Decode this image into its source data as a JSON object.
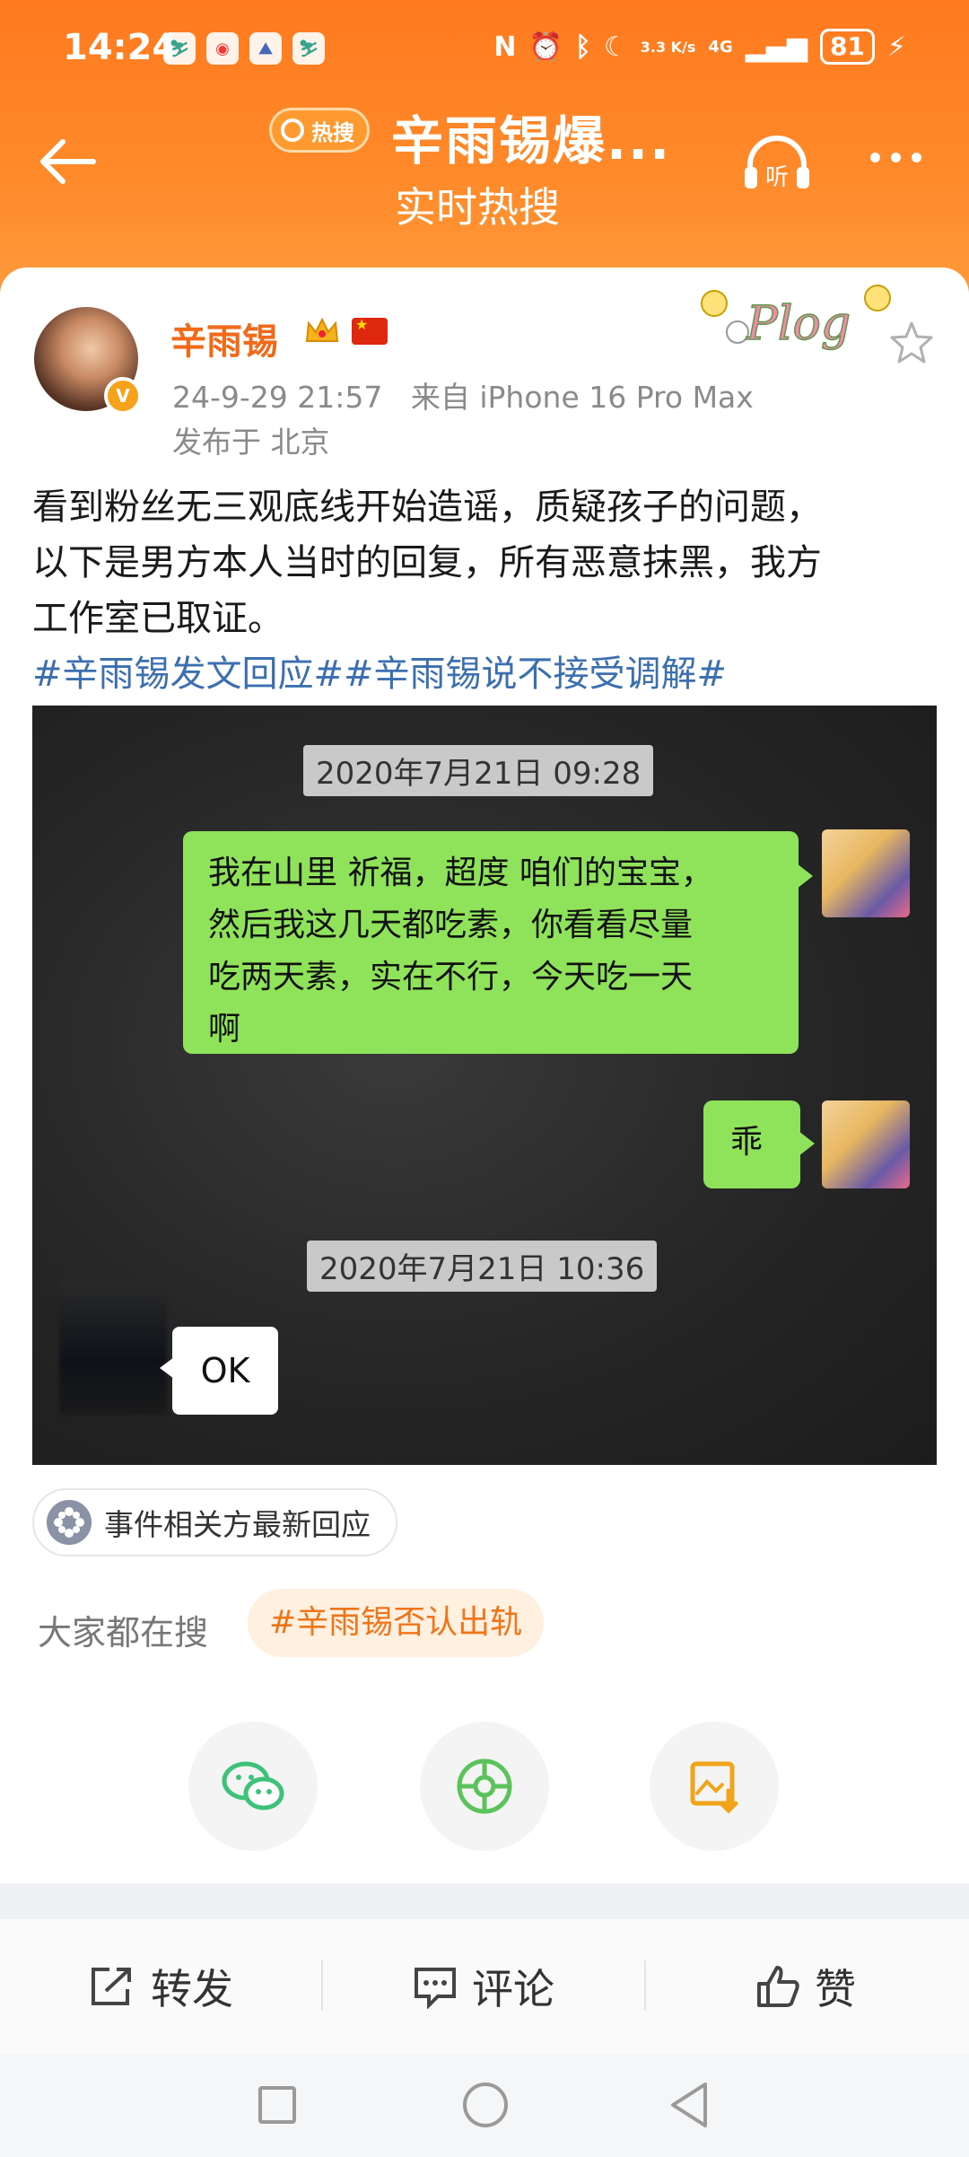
{
  "status_bar": {
    "time": "14:24",
    "net_speed": "3.3 K/s",
    "network": "4G",
    "battery": "81"
  },
  "header": {
    "hot_badge": "热搜",
    "title": "辛雨锡爆...",
    "subtitle": "实时热搜",
    "listen_label": "听"
  },
  "post": {
    "author": "辛雨锡",
    "timestamp": "24-9-29 21:57",
    "source": "来自 iPhone 16 Pro Max",
    "location": "发布于 北京",
    "body_lines": [
      "看到粉丝无三观底线开始造谣，质疑孩子的问题，",
      "以下是男方本人当时的回复，所有恶意抹黑，我方",
      "工作室已取证。"
    ],
    "hashtags": "#辛雨锡发文回应##辛雨锡说不接受调解#",
    "badge_text": "Plog",
    "verified_label": "V"
  },
  "screenshot": {
    "timestamp_1": "2020年7月21日 09:28",
    "message_1_lines": [
      "我在山里 祈福，超度 咱们的宝宝，",
      "然后我这几天都吃素，你看看尽量",
      "吃两天素，实在不行，今天吃一天",
      "啊"
    ],
    "message_2": "乖",
    "timestamp_2": "2020年7月21日 10:36",
    "reply": "OK"
  },
  "event_pill": "事件相关方最新回应",
  "search": {
    "label": "大家都在搜",
    "tag": "#辛雨锡否认出轨"
  },
  "share": {
    "icons": [
      "wechat-icon",
      "moments-icon",
      "save-image-icon"
    ]
  },
  "actions": {
    "repost": "转发",
    "comment": "评论",
    "like": "赞"
  },
  "colors": {
    "header_orange": "#ff7a1e",
    "username_orange": "#f06a1a",
    "hashtag_blue": "#3b6fb0",
    "chat_green": "#8fe35a"
  }
}
